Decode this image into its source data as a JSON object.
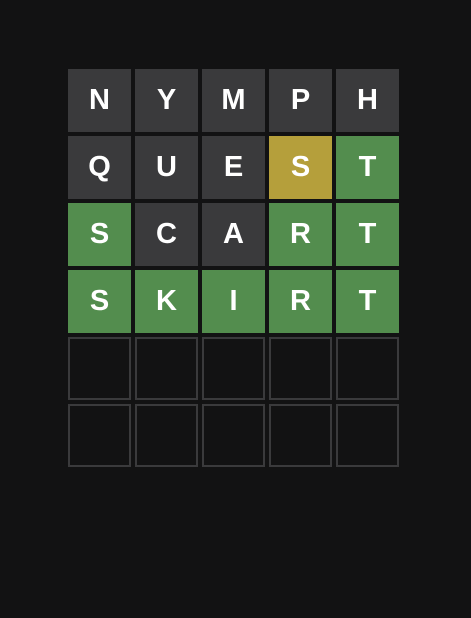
{
  "colors": {
    "background": "#121213",
    "absent": "#3a3a3c",
    "present": "#b59f3b",
    "correct": "#538d4e",
    "empty_border": "#3a3a3c"
  },
  "board": {
    "rows": [
      {
        "tiles": [
          {
            "letter": "N",
            "state": "absent"
          },
          {
            "letter": "Y",
            "state": "absent"
          },
          {
            "letter": "M",
            "state": "absent"
          },
          {
            "letter": "P",
            "state": "absent"
          },
          {
            "letter": "H",
            "state": "absent"
          }
        ]
      },
      {
        "tiles": [
          {
            "letter": "Q",
            "state": "absent"
          },
          {
            "letter": "U",
            "state": "absent"
          },
          {
            "letter": "E",
            "state": "absent"
          },
          {
            "letter": "S",
            "state": "present"
          },
          {
            "letter": "T",
            "state": "correct"
          }
        ]
      },
      {
        "tiles": [
          {
            "letter": "S",
            "state": "correct"
          },
          {
            "letter": "C",
            "state": "absent"
          },
          {
            "letter": "A",
            "state": "absent"
          },
          {
            "letter": "R",
            "state": "correct"
          },
          {
            "letter": "T",
            "state": "correct"
          }
        ]
      },
      {
        "tiles": [
          {
            "letter": "S",
            "state": "correct"
          },
          {
            "letter": "K",
            "state": "correct"
          },
          {
            "letter": "I",
            "state": "correct"
          },
          {
            "letter": "R",
            "state": "correct"
          },
          {
            "letter": "T",
            "state": "correct"
          }
        ]
      },
      {
        "tiles": [
          {
            "letter": "",
            "state": "empty"
          },
          {
            "letter": "",
            "state": "empty"
          },
          {
            "letter": "",
            "state": "empty"
          },
          {
            "letter": "",
            "state": "empty"
          },
          {
            "letter": "",
            "state": "empty"
          }
        ]
      },
      {
        "tiles": [
          {
            "letter": "",
            "state": "empty"
          },
          {
            "letter": "",
            "state": "empty"
          },
          {
            "letter": "",
            "state": "empty"
          },
          {
            "letter": "",
            "state": "empty"
          },
          {
            "letter": "",
            "state": "empty"
          }
        ]
      }
    ]
  }
}
